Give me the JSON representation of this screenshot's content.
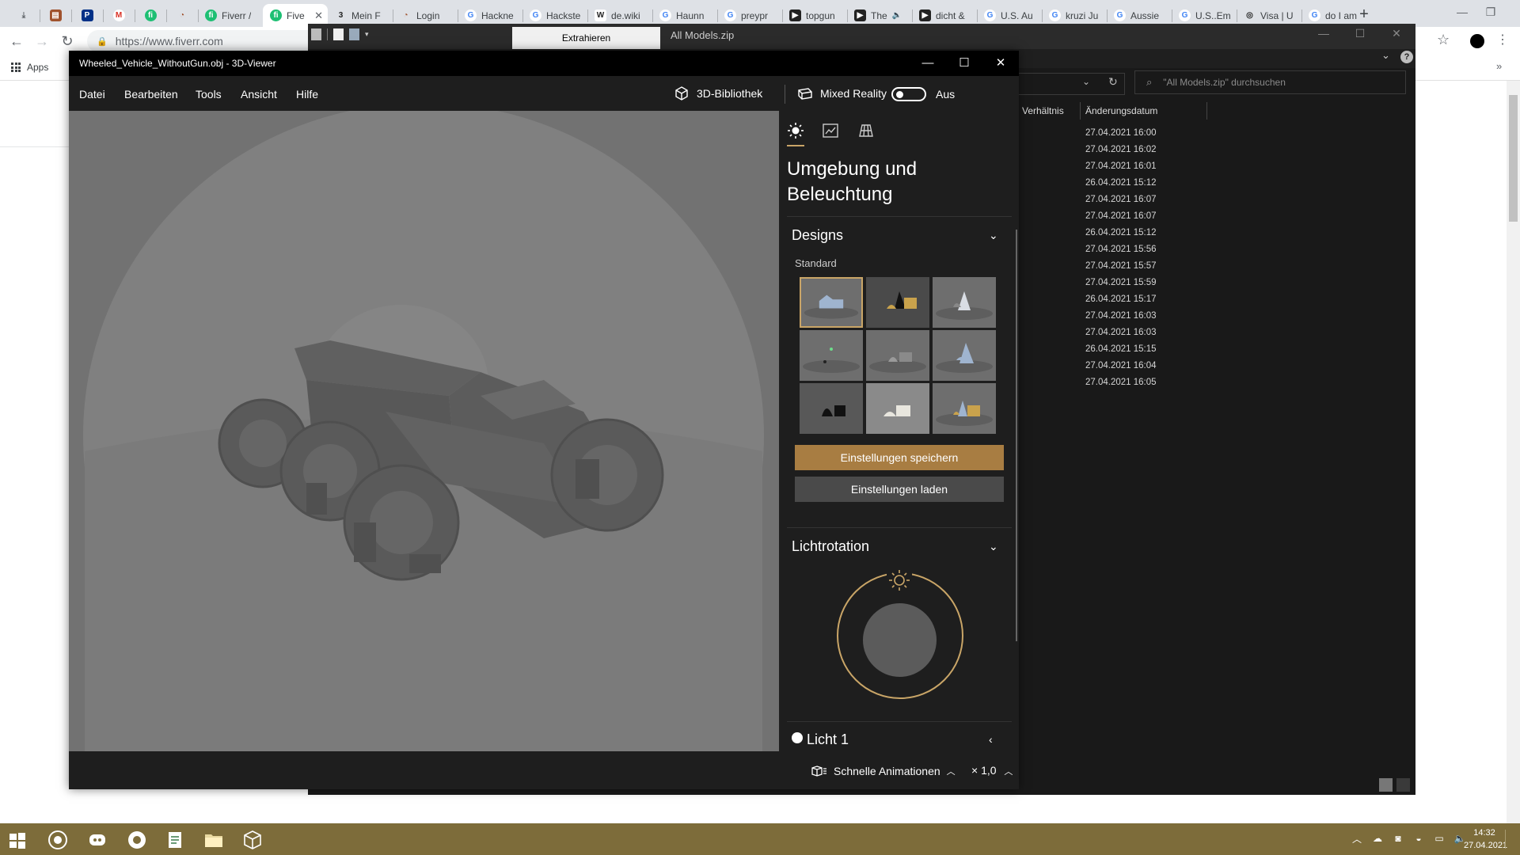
{
  "browser": {
    "tabs": [
      {
        "label": "",
        "icon": "download-icon",
        "pinned": true
      },
      {
        "label": "",
        "icon": "book-icon",
        "pinned": true
      },
      {
        "label": "",
        "icon": "paypal-icon",
        "pinned": true
      },
      {
        "label": "",
        "icon": "gmail-icon",
        "pinned": true
      },
      {
        "label": "",
        "icon": "fiverr-icon",
        "pinned": true
      },
      {
        "label": "",
        "icon": "timer-icon",
        "pinned": true
      },
      {
        "label": "Fiverr /",
        "icon": "fiverr-icon"
      },
      {
        "label": "Five",
        "icon": "fiverr-icon",
        "active": true
      },
      {
        "label": "Mein F",
        "icon": "three-icon"
      },
      {
        "label": "Login",
        "icon": "timer-icon"
      },
      {
        "label": "Hackne",
        "icon": "google-icon"
      },
      {
        "label": "Hackste",
        "icon": "google-icon"
      },
      {
        "label": "de.wiki",
        "icon": "wikipedia-icon"
      },
      {
        "label": "Haunn",
        "icon": "google-icon"
      },
      {
        "label": "preypr",
        "icon": "google-icon"
      },
      {
        "label": "topgun",
        "icon": "youtube-icon"
      },
      {
        "label": "The",
        "icon": "youtube-icon",
        "audio": true
      },
      {
        "label": "dicht &",
        "icon": "youtube-icon"
      },
      {
        "label": "U.S. Au",
        "icon": "google-icon"
      },
      {
        "label": "kruzi Ju",
        "icon": "google-icon"
      },
      {
        "label": "Aussie",
        "icon": "google-icon"
      },
      {
        "label": "U.S..Em",
        "icon": "google-icon"
      },
      {
        "label": "Visa | U",
        "icon": "visa-icon"
      },
      {
        "label": "do I am",
        "icon": "google-icon"
      }
    ],
    "url": "https://www.fiverr.com",
    "apps_label": "Apps"
  },
  "explorer": {
    "tab_extract": "Extrahieren",
    "title": "All Models.zip",
    "search_placeholder": "\"All Models.zip\" durchsuchen",
    "col_ratio": "Verhältnis",
    "col_date": "Änderungsdatum",
    "dates": [
      "27.04.2021 16:00",
      "27.04.2021 16:02",
      "27.04.2021 16:01",
      "26.04.2021 15:12",
      "27.04.2021 16:07",
      "27.04.2021 16:07",
      "26.04.2021 15:12",
      "27.04.2021 15:56",
      "27.04.2021 15:57",
      "27.04.2021 15:59",
      "26.04.2021 15:17",
      "27.04.2021 16:03",
      "27.04.2021 16:03",
      "26.04.2021 15:15",
      "27.04.2021 16:04",
      "27.04.2021 16:05"
    ]
  },
  "viewer": {
    "title": "Wheeled_Vehicle_WithoutGun.obj - 3D-Viewer",
    "menu": [
      "Datei",
      "Bearbeiten",
      "Tools",
      "Ansicht",
      "Hilfe"
    ],
    "library_label": "3D-Bibliothek",
    "mixed_reality_label": "Mixed Reality",
    "mixed_reality_state": "Aus",
    "panel": {
      "heading": "Umgebung und Beleuchtung",
      "designs_title": "Designs",
      "standard_label": "Standard",
      "selected_theme": 0,
      "save_button": "Einstellungen speichern",
      "load_button": "Einstellungen laden",
      "light_rotation_title": "Lichtrotation",
      "light1_label": "Licht 1"
    },
    "animations_label": "Schnelle Animationen",
    "speed_label": "× 1,0"
  },
  "taskbar": {
    "time": "14:32",
    "date": "27.04.2021"
  },
  "colors": {
    "accent_gold": "#c9a567",
    "save_button": "#a87d42",
    "taskbar": "#7d6c3a",
    "viewport": "#777777"
  }
}
